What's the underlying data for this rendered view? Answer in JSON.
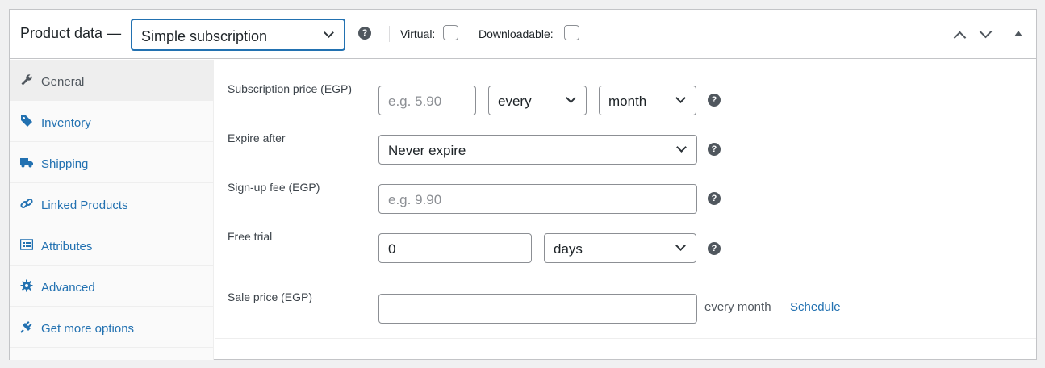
{
  "header": {
    "title": "Product data —",
    "product_type": "Simple subscription",
    "virtual_label": "Virtual:",
    "downloadable_label": "Downloadable:"
  },
  "sidebar": {
    "items": [
      {
        "label": "General",
        "icon": "wrench-icon",
        "active": true
      },
      {
        "label": "Inventory",
        "icon": "tag-icon"
      },
      {
        "label": "Shipping",
        "icon": "truck-icon"
      },
      {
        "label": "Linked Products",
        "icon": "link-icon"
      },
      {
        "label": "Attributes",
        "icon": "list-icon"
      },
      {
        "label": "Advanced",
        "icon": "gear-icon"
      },
      {
        "label": "Get more options",
        "icon": "plugin-icon"
      }
    ]
  },
  "fields": {
    "subscription_price": {
      "label": "Subscription price (EGP)",
      "placeholder": "e.g. 5.90",
      "interval": "every",
      "period": "month"
    },
    "expire_after": {
      "label": "Expire after",
      "value": "Never expire"
    },
    "signup_fee": {
      "label": "Sign-up fee (EGP)",
      "placeholder": "e.g. 9.90"
    },
    "free_trial": {
      "label": "Free trial",
      "value": "0",
      "unit": "days"
    },
    "sale_price": {
      "label": "Sale price (EGP)",
      "value": "",
      "suffix": "every month",
      "schedule_link": "Schedule"
    }
  },
  "help_glyph": "?",
  "colors": {
    "accent": "#2271b1",
    "border": "#c3c4c7",
    "help_icon": "#50575e"
  }
}
